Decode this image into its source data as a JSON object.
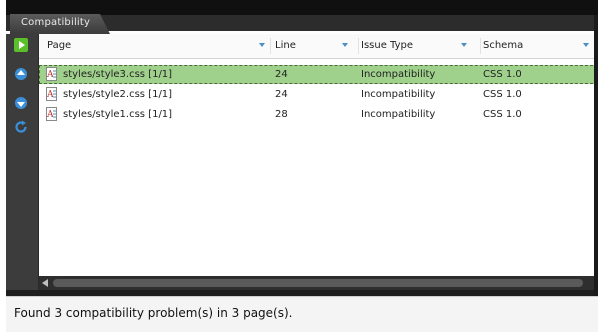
{
  "panel": {
    "tab_label": "Compatibility"
  },
  "toolbar": {
    "buttons": [
      {
        "icon": "run-icon",
        "color": "#5bbf2a"
      },
      {
        "icon": "arrow-up-icon",
        "color": "#3a8fd8"
      },
      {
        "icon": "arrow-down-icon",
        "color": "#3a8fd8"
      },
      {
        "icon": "refresh-icon",
        "color": "#3a8fd8"
      }
    ]
  },
  "table": {
    "columns": [
      "Page",
      "Line",
      "Issue Type",
      "Schema"
    ],
    "rows": [
      {
        "page": "styles/style3.css [1/1]",
        "line": "24",
        "issue": "Incompatibility",
        "schema": "CSS 1.0",
        "selected": true
      },
      {
        "page": "styles/style2.css [1/1]",
        "line": "24",
        "issue": "Incompatibility",
        "schema": "CSS 1.0",
        "selected": false
      },
      {
        "page": "styles/style1.css [1/1]",
        "line": "28",
        "issue": "Incompatibility",
        "schema": "CSS 1.0",
        "selected": false
      }
    ]
  },
  "status": {
    "text": "Found 3 compatibility problem(s) in 3 page(s)."
  },
  "colors": {
    "selected_row": "#9fd18c",
    "header_arrow": "#4a8fc4"
  }
}
